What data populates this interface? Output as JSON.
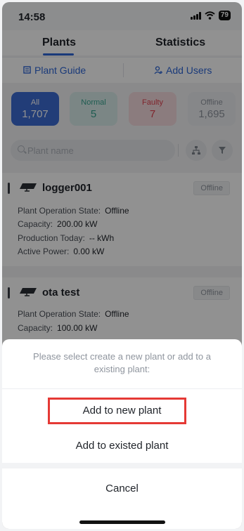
{
  "status_bar": {
    "time": "14:58",
    "battery": "79"
  },
  "tabs": [
    {
      "label": "Plants"
    },
    {
      "label": "Statistics"
    }
  ],
  "links": {
    "plant_guide": "Plant Guide",
    "add_users": "Add Users"
  },
  "counts": [
    {
      "label": "All",
      "value": "1,707"
    },
    {
      "label": "Normal",
      "value": "5"
    },
    {
      "label": "Faulty",
      "value": "7"
    },
    {
      "label": "Offline",
      "value": "1,695"
    }
  ],
  "search": {
    "placeholder": "Plant name"
  },
  "plants": [
    {
      "name": "logger001",
      "status": "Offline",
      "rows": [
        {
          "label": "Plant Operation State:",
          "value": "Offline"
        },
        {
          "label": "Capacity:",
          "value": "200.00 kW"
        },
        {
          "label": "Production Today:",
          "value": "-- kWh"
        },
        {
          "label": "Active Power:",
          "value": "0.00 kW"
        }
      ]
    },
    {
      "name": "ota test",
      "status": "Offline",
      "rows": [
        {
          "label": "Plant Operation State:",
          "value": "Offline"
        },
        {
          "label": "Capacity:",
          "value": "100.00 kW"
        }
      ]
    }
  ],
  "sheet": {
    "message": "Please select create a new plant or add to a existing plant:",
    "add_new": "Add to new plant",
    "add_existed": "Add to existed plant",
    "cancel": "Cancel"
  }
}
